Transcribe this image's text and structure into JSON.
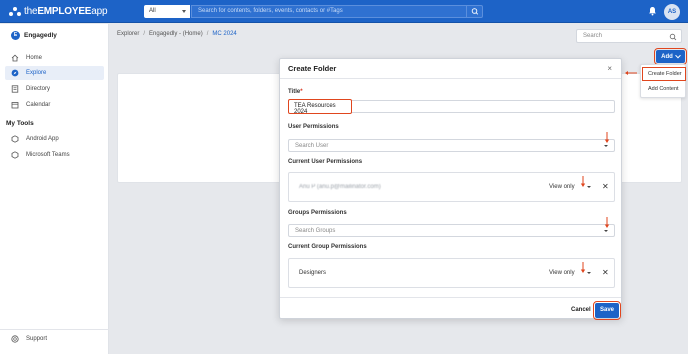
{
  "app": {
    "logo_prefix": "the",
    "logo_brand": "EMPLOYEE",
    "logo_suffix": "app",
    "scope_value": "All",
    "search_placeholder": "Search for contents, folders, events, contacts or #Tags",
    "avatar_initials": "AS",
    "colors": {
      "primary": "#1d63c7",
      "highlight": "#e0461e"
    }
  },
  "sidebar": {
    "org_name": "Engagedly",
    "org_initial": "E",
    "items": [
      {
        "label": "Home",
        "icon": "home-icon",
        "active": false
      },
      {
        "label": "Explore",
        "icon": "compass-icon",
        "active": true
      },
      {
        "label": "Directory",
        "icon": "directory-icon",
        "active": false
      },
      {
        "label": "Calendar",
        "icon": "calendar-icon",
        "active": false
      }
    ],
    "tools_title": "My Tools",
    "tools": [
      {
        "label": "Android App",
        "icon": "android-icon"
      },
      {
        "label": "Microsoft Teams",
        "icon": "teams-icon"
      }
    ],
    "support_label": "Support"
  },
  "main": {
    "breadcrumb": [
      "Explorer",
      "Engagedly - (Home)",
      "MC 2024"
    ],
    "search_placeholder": "Search",
    "add_label": "Add",
    "add_menu": [
      "Create Folder",
      "Add Content"
    ]
  },
  "modal": {
    "title": "Create Folder",
    "title_label": "Title",
    "title_required_mark": "*",
    "title_value": "TEA Resources 2024",
    "user_permissions_label": "User Permissions",
    "search_user_placeholder": "Search User",
    "current_user_permissions_label": "Current User Permissions",
    "current_user": {
      "name": "Anu P (anu.p@mailinator.com)",
      "role": "View only"
    },
    "group_permissions_label": "Groups Permissions",
    "search_groups_placeholder": "Search Groups",
    "current_group_permissions_label": "Current Group Permissions",
    "current_group": {
      "name": "Designers",
      "role": "View only"
    },
    "cancel_label": "Cancel",
    "save_label": "Save"
  }
}
